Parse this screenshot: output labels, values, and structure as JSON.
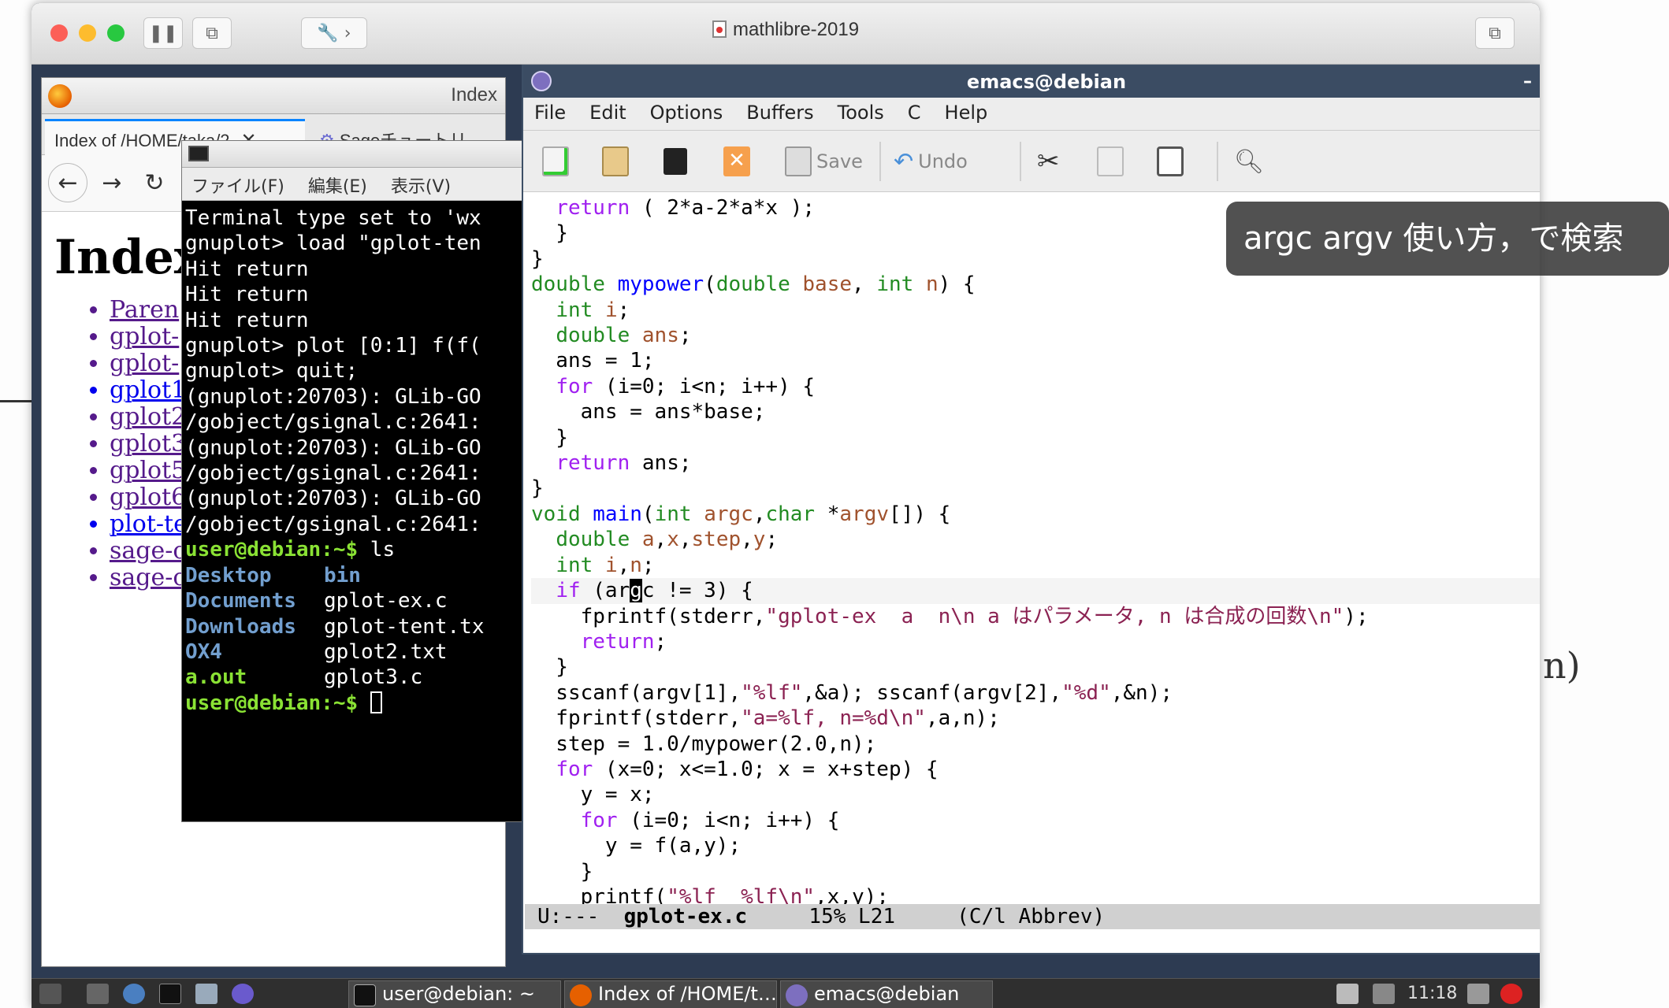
{
  "vm": {
    "title": "mathlibre-2019"
  },
  "browser": {
    "title": "Index",
    "tabs": [
      {
        "label": "Index of /HOME/taka/2",
        "active": true
      },
      {
        "label": "Sageチュートリ",
        "active": false
      }
    ],
    "heading": "Index",
    "links": [
      "Paren",
      "gplot-",
      "gplot-",
      "gplot1",
      "gplot2",
      "gplot3",
      "gplot5",
      "gplot6",
      "plot-te",
      "sage-c",
      "sage-c"
    ]
  },
  "terminal": {
    "menu": [
      "ファイル(F)",
      "編集(E)",
      "表示(V)"
    ],
    "lines": [
      {
        "text": "Terminal type set to 'wx"
      },
      {
        "text": "gnuplot> load \"gplot-ten"
      },
      {
        "text": "Hit return"
      },
      {
        "text": "Hit return"
      },
      {
        "text": "Hit return"
      },
      {
        "text": "gnuplot> plot [0:1] f(f("
      },
      {
        "text": "gnuplot> quit;"
      },
      {
        "text": ""
      },
      {
        "text": "(gnuplot:20703): GLib-GO"
      },
      {
        "text": "/gobject/gsignal.c:2641:"
      },
      {
        "text": ""
      },
      {
        "text": "(gnuplot:20703): GLib-GO"
      },
      {
        "text": "/gobject/gsignal.c:2641:"
      },
      {
        "text": ""
      },
      {
        "text": "(gnuplot:20703): GLib-GO"
      },
      {
        "text": "/gobject/gsignal.c:2641:"
      }
    ],
    "prompt": "user@debian:~$",
    "ls_command": " ls",
    "ls_rows": [
      {
        "left": "Desktop",
        "right": "bin",
        "left_kind": "dir",
        "right_kind": "dir"
      },
      {
        "left": "Documents",
        "right": "gplot-ex.c",
        "left_kind": "dir",
        "right_kind": "file"
      },
      {
        "left": "Downloads",
        "right": "gplot-tent.tx",
        "left_kind": "dir",
        "right_kind": "file"
      },
      {
        "left": "OX4",
        "right": "gplot2.txt",
        "left_kind": "dir",
        "right_kind": "file"
      },
      {
        "left": "a.out",
        "right": "gplot3.c",
        "left_kind": "exe",
        "right_kind": "file"
      }
    ]
  },
  "emacs": {
    "title": "emacs@debian",
    "menu": [
      "File",
      "Edit",
      "Options",
      "Buffers",
      "Tools",
      "C",
      "Help"
    ],
    "toolbar": {
      "save": "Save",
      "undo": "Undo"
    },
    "modeline": {
      "status": "U:---",
      "buffer": "gplot-ex.c",
      "position": "15% L21",
      "mode": "(C/l Abbrev)"
    }
  },
  "overlay": {
    "text": "argc argv 使い方，で検索"
  },
  "taskbar": {
    "tasks": [
      "user@debian: ~",
      "Index of /HOME/t…",
      "emacs@debian"
    ],
    "clock": "11:18"
  },
  "handwriting": {
    "right": "n)"
  }
}
